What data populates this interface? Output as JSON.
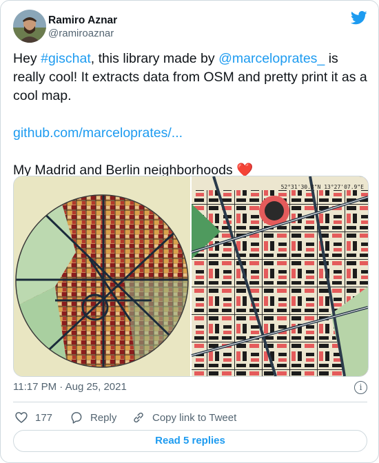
{
  "author": {
    "name": "Ramiro Aznar",
    "handle": "@ramiroaznar"
  },
  "tweet": {
    "text_prefix": "Hey ",
    "hashtag": "#gischat",
    "text_mid": ", this library made by ",
    "mention": "@marceloprates_",
    "text_suffix": " is really cool! It extracts data from OSM and pretty print it as a cool map.",
    "link": "github.com/marceloprates/...",
    "closing": "My Madrid and Berlin neighborhoods",
    "emoji": "❤️"
  },
  "media": {
    "coords_label": "52°31'30.8\"N 13°27'07.9\"E"
  },
  "meta": {
    "timestamp": "11:17 PM · Aug 25, 2021",
    "info_symbol": "i"
  },
  "actions": {
    "like_count": "177",
    "reply_label": "Reply",
    "copy_label": "Copy link to Tweet"
  },
  "footer": {
    "read_replies_label": "Read 5 replies"
  },
  "colors": {
    "link": "#1d9bf0",
    "heart": "#e0245e",
    "map_bg": "#e9e6c2"
  },
  "icons": [
    "twitter-bird-icon",
    "info-icon",
    "heart-icon",
    "reply-icon",
    "copy-link-icon"
  ]
}
